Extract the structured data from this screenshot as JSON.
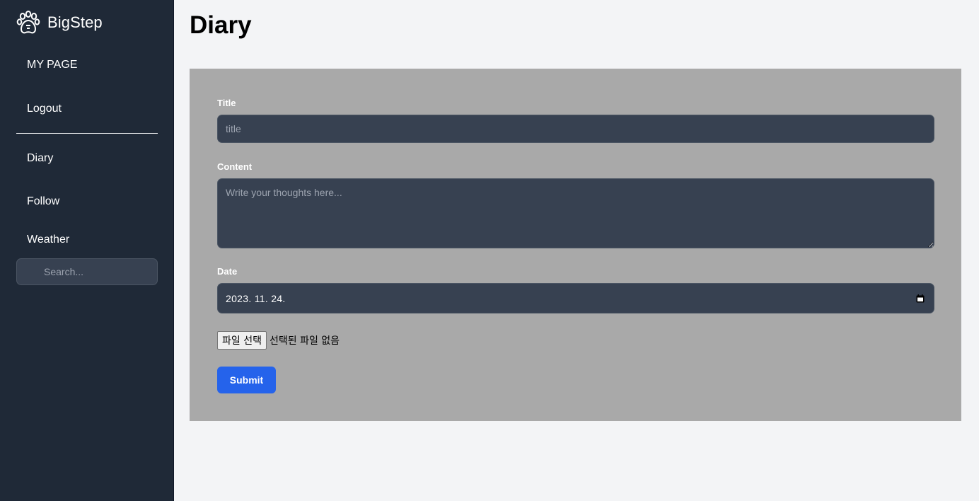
{
  "sidebar": {
    "brand": {
      "name": "BigStep",
      "icon": "paw-icon"
    },
    "top_items": [
      {
        "label": "MY PAGE"
      },
      {
        "label": "Logout"
      }
    ],
    "items": [
      {
        "label": "Diary"
      },
      {
        "label": "Follow"
      },
      {
        "label": "Weather"
      }
    ],
    "search": {
      "placeholder": "Search...",
      "icon": "search-icon"
    }
  },
  "main": {
    "title": "Diary",
    "form": {
      "title_label": "Title",
      "title_placeholder": "title",
      "content_label": "Content",
      "content_placeholder": "Write your thoughts here...",
      "date_label": "Date",
      "date_value": "2023. 11. 24.",
      "date_icon": "calendar-icon",
      "file_button_label": "파일 선택",
      "file_status": "선택된 파일 없음",
      "submit_label": "Submit"
    }
  },
  "colors": {
    "sidebar_bg": "#1f2937",
    "page_bg": "#f3f4f6",
    "form_bg": "#a9a9a9",
    "input_bg": "#374151",
    "accent": "#2563eb"
  }
}
